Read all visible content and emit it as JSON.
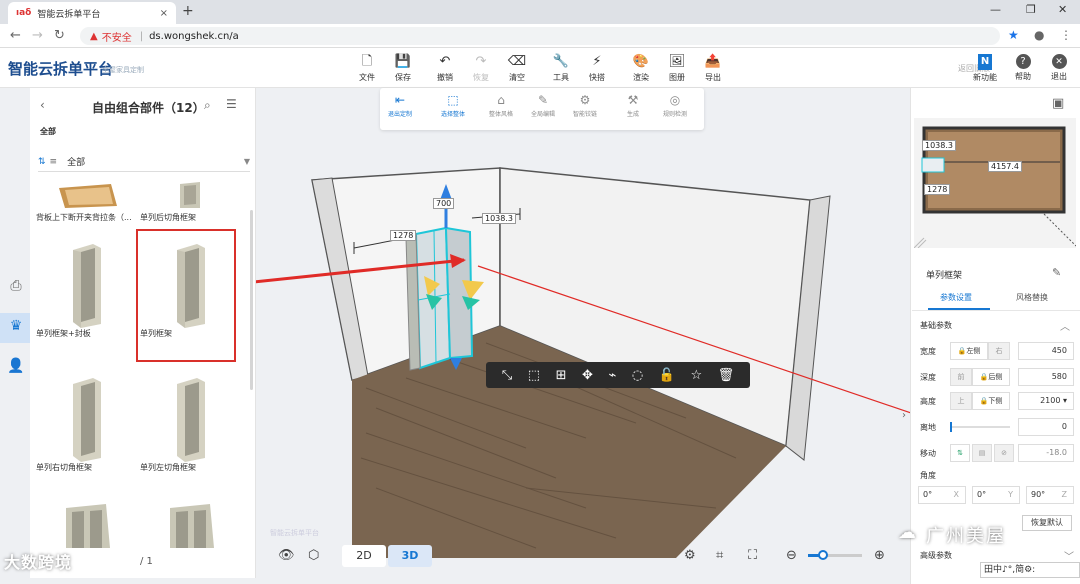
{
  "browser": {
    "tab_title": "智能云拆单平台",
    "favicon": "ıaδ",
    "new_tab": "+",
    "url_warning": "不安全",
    "url": "ds.wongshek.cn/a",
    "win_min": "—",
    "win_max": "❐",
    "win_close": "✕",
    "tab_close": "×"
  },
  "app": {
    "logo": "智能云拆单平台",
    "logo_sub": "全屋家具定制",
    "back_link": "返回旧版",
    "toolbar": [
      {
        "label": "文件",
        "icon": "🗋"
      },
      {
        "label": "保存",
        "icon": "💾"
      },
      {
        "label": "撤销",
        "icon": "↶"
      },
      {
        "label": "恢复",
        "icon": "↷"
      },
      {
        "label": "清空",
        "icon": "⌫"
      },
      {
        "label": "工具",
        "icon": "🔧"
      },
      {
        "label": "快搭",
        "icon": "⚡"
      },
      {
        "label": "渲染",
        "icon": "🎨"
      },
      {
        "label": "图册",
        "icon": "🖼"
      },
      {
        "label": "导出",
        "icon": "📤"
      }
    ],
    "right_actions": [
      {
        "label": "新功能",
        "icon": "N"
      },
      {
        "label": "帮助",
        "icon": "?"
      },
      {
        "label": "退出",
        "icon": "✕"
      }
    ]
  },
  "left_panel": {
    "title": "自由组合部件（12）",
    "category": "全部",
    "filter_value": "全部",
    "items": [
      {
        "label": "背板上下断开夹背拉条（..."
      },
      {
        "label": "单列后切角框架"
      },
      {
        "label": "单列框架+封板"
      },
      {
        "label": "单列框架"
      },
      {
        "label": "单列右切角框架"
      },
      {
        "label": "单列左切角框架"
      }
    ],
    "page": "/ 1",
    "watermark": "大数跨境"
  },
  "viewport": {
    "tools": [
      {
        "label": "退出定制",
        "icon": "⇤"
      },
      {
        "label": "选择整体",
        "icon": "⬚"
      },
      {
        "label": "整体风格",
        "icon": "⌂"
      },
      {
        "label": "全局编辑",
        "icon": "✎"
      },
      {
        "label": "智能铰链",
        "icon": "⚙"
      },
      {
        "label": "生成",
        "icon": "⚒"
      },
      {
        "label": "规则检测",
        "icon": "◎"
      }
    ],
    "dims": {
      "height": "700",
      "width": "1278",
      "depth": "1038.3"
    },
    "context_menu": [
      "⤡",
      "⬚",
      "⊞",
      "✥",
      "⌁",
      "◌",
      "🔓",
      "☆",
      "🗑"
    ],
    "mode_2d": "2D",
    "mode_3d": "3D",
    "watermark": "智能云拆单平台"
  },
  "right_panel": {
    "minimap_dims": {
      "left": "1038.3",
      "bottom": "1278",
      "center": "4157.4"
    },
    "title": "单列框架",
    "tab_params": "参数设置",
    "tab_style": "风格替换",
    "section_basic": "基础参数",
    "params": [
      {
        "label": "宽度",
        "a": "左侧",
        "b": "右",
        "value": "450"
      },
      {
        "label": "深度",
        "a": "前",
        "b": "后侧",
        "value": "580"
      },
      {
        "label": "高度",
        "a": "上",
        "b": "下侧",
        "value": "2100"
      },
      {
        "label": "离地",
        "value": "0"
      },
      {
        "label": "移动",
        "value": "-18.0"
      }
    ],
    "angle_label": "角度",
    "angles": [
      {
        "value": "0°",
        "axis": "X"
      },
      {
        "value": "0°",
        "axis": "Y"
      },
      {
        "value": "90°",
        "axis": "Z"
      }
    ],
    "reset": "恢复默认",
    "more_params": "高级参数",
    "watermark": "广州美屋",
    "ime": "田中♪°,简⚙:"
  }
}
